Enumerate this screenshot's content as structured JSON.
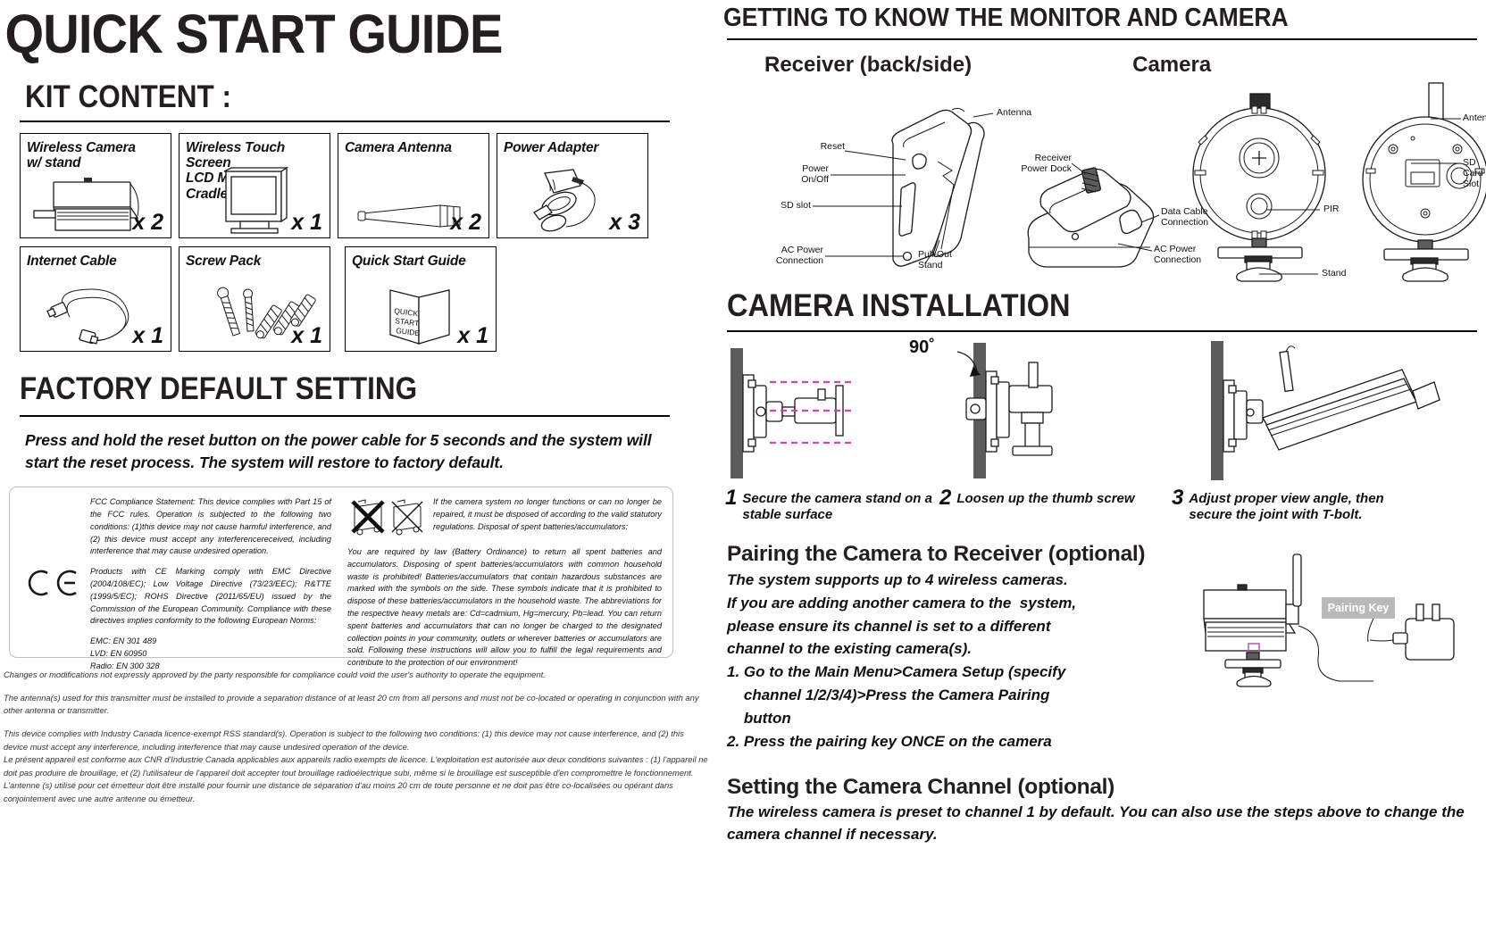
{
  "document": {
    "title": "QUICK START GUIDE"
  },
  "left": {
    "kit": {
      "heading": "KIT CONTENT :",
      "items": [
        {
          "label_line1": "Wireless Camera",
          "label_line2": "w/ stand",
          "qty": "x 2",
          "icon": "camera-icon"
        },
        {
          "label_line1": "Wireless Touch Screen",
          "label_line2": "LCD Monitor w/ Cradle",
          "qty": "x 1",
          "icon": "monitor-icon"
        },
        {
          "label_line1": "Camera Antenna",
          "label_line2": "",
          "qty": "x 2",
          "icon": "antenna-icon"
        },
        {
          "label_line1": "Power Adapter",
          "label_line2": "",
          "qty": "x 3",
          "icon": "power-adapter-icon"
        },
        {
          "label_line1": "Internet Cable",
          "label_line2": "",
          "qty": "x 1",
          "icon": "ethernet-cable-icon"
        },
        {
          "label_line1": "Screw Pack",
          "label_line2": "",
          "qty": "x 1",
          "icon": "screws-icon"
        },
        {
          "label_line1": "Quick Start Guide",
          "label_line2": "",
          "qty": "x 1",
          "icon": "booklet-icon"
        }
      ],
      "booklet_text": [
        "QUICK",
        "START",
        "GUIDE"
      ]
    },
    "factory": {
      "heading": "FACTORY DEFAULT SETTING",
      "body": "Press and hold the reset button on the power cable for 5 seconds and the system will start the reset process. The system will restore to factory default."
    },
    "compliance": {
      "fcc": "FCC Compliance Statement: This device complies with Part 15 of the FCC rules. Operation is subjected to the following two conditions: (1)this device may not cause harmful interference, and (2) this device must accept any  interferencereceived, including interference that may cause undesired operation.",
      "ce": "Products with CE Marking comply with EMC Directive (2004/108/EC); Low Voltage Directive (73/23/EEC); R&TTE (1999/5/EC); ROHS Directive (2011/65/EU) issued by the Commission of the European  Community. Compliance with these directives implies conformity to the following European Norms:",
      "norms": [
        "EMC: EN 301 489",
        "LVD: EN 60950",
        "Radio: EN 300 328"
      ],
      "ce_mark": "CE",
      "disposal_intro": "If the camera system no longer functions or can no longer be repaired, it must be disposed of according to the valid statutory regulations. Disposal of spent batteries/accumulators:",
      "disposal_body": "You are required by law (Battery Ordinance) to return all spent batteries and accumulators. Disposing of spent batteries/accumulators with common household waste is prohibited!  Batteries/accumulators that contain hazardous substances are marked with the symbols on the side. These symbols indicate that it is prohibited to dispose of these batteries/accumulators in the household waste. The abbreviations for the respective heavy metals are: Cd=cadmium, Hg=mercury, Pb=lead. You can return spent batteries and accumulators that can no longer be charged to the designated collection points in your community, outlets or wherever batteries or accumulators are sold. Following these instructions will allow you to fulfill the legal requirements and contribute to the protection of our environment!"
    },
    "legal": [
      "Changes or modifications not expressly approved by the party responsible for compliance could void the user's authority to operate the equipment.",
      "The antenna(s) used for this transmitter must be installed to provide a separation distance of at least 20 cm from all persons and must not be co-located or operating in conjunction with any other antenna or transmitter.",
      "This device complies with Industry Canada licence-exempt RSS standard(s). Operation is subject to the following two conditions: (1) this device may not cause interference, and (2) this device must accept any interference, including interference that may cause undesired operation of the device.\nLe présent appareil est conforme aux CNR d'Industrie Canada applicables aux appareils radio exempts de licence. L'exploitation est autorisée aux deux conditions suivantes : (1) l'appareil ne doit pas produire de brouillage, et (2) l'utilisateur de l'appareil doit accepter tout brouillage radioélectrique subi, même si le brouillage est susceptible d'en compromettre le fonctionnement.\nL'antenne (s) utilisé pour cet émetteur doit être installé pour fournir une distance de séparation d'au moins 20 cm de toute personne et ne doit pas être co-localisées ou opérant dans conjointement avec une autre antenne ou émetteur."
    ]
  },
  "right": {
    "getting_to_know": {
      "heading": "GETTING TO KNOW THE MONITOR AND CAMERA",
      "receiver_title": "Receiver (back/side)",
      "camera_title": "Camera",
      "receiver_labels": {
        "reset": "Reset",
        "power_on_off": "Power\nOn/Off",
        "sd_slot": "SD slot",
        "ac_power": "AC Power\nConnection",
        "antenna": "Antenna",
        "pull_out_stand": "Pull-Out\nStand",
        "receiver_power_dock": "Receiver\nPower Dock",
        "data_cable": "Data Cable\nConnection",
        "ac_power_dock": "AC Power\nConnection"
      },
      "camera_labels": {
        "pir": "PIR",
        "stand": "Stand",
        "antenna": "Antenna",
        "sd_card_slot": "SD Card Slot"
      }
    },
    "installation": {
      "heading": "CAMERA INSTALLATION",
      "angle_label": "90˚",
      "steps": [
        {
          "num": "1",
          "text": "Secure  the camera stand on a stable surface"
        },
        {
          "num": "2",
          "text": "Loosen up the thumb screw"
        },
        {
          "num": "3",
          "text": "Adjust proper view angle, then secure the joint with T-bolt."
        }
      ]
    },
    "pairing": {
      "heading": "Pairing the Camera to Receiver (optional)",
      "lines": [
        "The system supports up to 4 wireless cameras.",
        "If you are adding another camera to the  system,",
        "please ensure its channel is set to a different",
        "channel to the existing camera(s).",
        "1. Go to the Main Menu>Camera Setup (specify",
        "    channel 1/2/3/4)>Press the Camera Pairing",
        "    button",
        "2. Press the pairing key ONCE on the camera"
      ],
      "key_badge": "Pairing Key"
    },
    "channel": {
      "heading": "Setting the Camera Channel (optional)",
      "body": "The wireless camera is preset to channel 1 by default. You can also use the steps above to change the camera channel if necessary."
    }
  }
}
